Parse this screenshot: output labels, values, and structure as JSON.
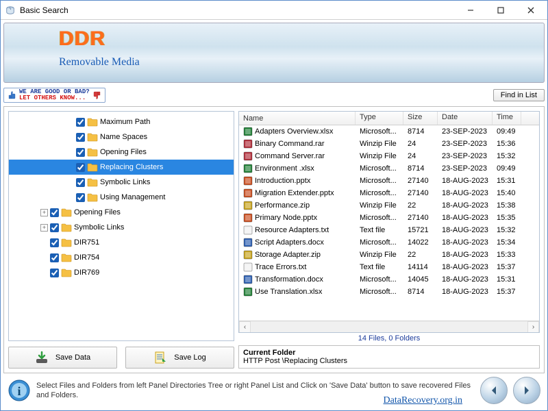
{
  "titlebar": {
    "title": "Basic Search"
  },
  "banner": {
    "logo": "DDR",
    "subtitle": "Removable Media"
  },
  "slogan": {
    "line1": "WE ARE GOOD OR BAD?",
    "line2": "LET OTHERS KNOW..."
  },
  "buttons": {
    "find_in_list": "Find in List",
    "save_data": "Save Data",
    "save_log": "Save Log"
  },
  "tree": [
    {
      "indent": 2,
      "exp": "none",
      "checked": true,
      "label": "Maximum Path"
    },
    {
      "indent": 2,
      "exp": "none",
      "checked": true,
      "label": "Name Spaces"
    },
    {
      "indent": 2,
      "exp": "none",
      "checked": true,
      "label": "Opening Files"
    },
    {
      "indent": 2,
      "exp": "none",
      "checked": true,
      "label": "Replacing Clusters",
      "selected": true
    },
    {
      "indent": 2,
      "exp": "none",
      "checked": true,
      "label": "Symbolic Links"
    },
    {
      "indent": 2,
      "exp": "none",
      "checked": true,
      "label": "Using Management"
    },
    {
      "indent": 1,
      "exp": "plus",
      "checked": true,
      "label": "Opening Files"
    },
    {
      "indent": 1,
      "exp": "plus",
      "checked": true,
      "label": "Symbolic Links"
    },
    {
      "indent": 1,
      "exp": "none",
      "checked": true,
      "label": "DIR751"
    },
    {
      "indent": 1,
      "exp": "none",
      "checked": true,
      "label": "DIR754"
    },
    {
      "indent": 1,
      "exp": "none",
      "checked": true,
      "label": "DIR769"
    }
  ],
  "columns": {
    "name": "Name",
    "type": "Type",
    "size": "Size",
    "date": "Date",
    "time": "Time"
  },
  "files": [
    {
      "icon": "xls",
      "name": "Adapters Overview.xlsx",
      "type": "Microsoft...",
      "size": "8714",
      "date": "23-SEP-2023",
      "time": "09:49"
    },
    {
      "icon": "rar",
      "name": "Binary Command.rar",
      "type": "Winzip File",
      "size": "24",
      "date": "23-SEP-2023",
      "time": "15:36"
    },
    {
      "icon": "rar",
      "name": "Command Server.rar",
      "type": "Winzip File",
      "size": "24",
      "date": "23-SEP-2023",
      "time": "15:32"
    },
    {
      "icon": "xls",
      "name": "Environment .xlsx",
      "type": "Microsoft...",
      "size": "8714",
      "date": "23-SEP-2023",
      "time": "09:49"
    },
    {
      "icon": "ppt",
      "name": "Introduction.pptx",
      "type": "Microsoft...",
      "size": "27140",
      "date": "18-AUG-2023",
      "time": "15:31"
    },
    {
      "icon": "ppt",
      "name": "Migration Extender.pptx",
      "type": "Microsoft...",
      "size": "27140",
      "date": "18-AUG-2023",
      "time": "15:40"
    },
    {
      "icon": "zip",
      "name": "Performance.zip",
      "type": "Winzip File",
      "size": "22",
      "date": "18-AUG-2023",
      "time": "15:38"
    },
    {
      "icon": "ppt",
      "name": "Primary Node.pptx",
      "type": "Microsoft...",
      "size": "27140",
      "date": "18-AUG-2023",
      "time": "15:35"
    },
    {
      "icon": "txt",
      "name": "Resource Adapters.txt",
      "type": "Text file",
      "size": "15721",
      "date": "18-AUG-2023",
      "time": "15:32"
    },
    {
      "icon": "doc",
      "name": "Script Adapters.docx",
      "type": "Microsoft...",
      "size": "14022",
      "date": "18-AUG-2023",
      "time": "15:34"
    },
    {
      "icon": "zip",
      "name": "Storage Adapter.zip",
      "type": "Winzip File",
      "size": "22",
      "date": "18-AUG-2023",
      "time": "15:33"
    },
    {
      "icon": "txt",
      "name": "Trace Errors.txt",
      "type": "Text file",
      "size": "14114",
      "date": "18-AUG-2023",
      "time": "15:37"
    },
    {
      "icon": "doc",
      "name": "Transformation.docx",
      "type": "Microsoft...",
      "size": "14045",
      "date": "18-AUG-2023",
      "time": "15:31"
    },
    {
      "icon": "xls",
      "name": "Use Translation.xlsx",
      "type": "Microsoft...",
      "size": "8714",
      "date": "18-AUG-2023",
      "time": "15:37"
    }
  ],
  "status": "14 Files, 0 Folders",
  "current_folder": {
    "heading": "Current Folder",
    "path": "HTTP Post \\Replacing Clusters"
  },
  "hint": "Select Files and Folders from left Panel Directories Tree or right Panel List and Click on 'Save Data' button to save recovered Files and Folders.",
  "watermark": "DataRecovery.org.in",
  "icon_colors": {
    "xls": "#1e7e34",
    "rar": "#b02a37",
    "ppt": "#c94b1c",
    "zip": "#c6a21a",
    "txt": "#f0f0f0",
    "doc": "#2a5db0"
  }
}
